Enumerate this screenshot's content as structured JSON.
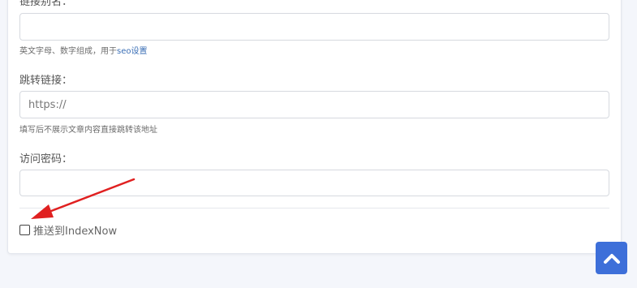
{
  "form": {
    "slug_label": "链接别名：",
    "slug_value": "",
    "slug_help_prefix": "英文字母、数字组成，用于",
    "slug_help_link": "seo设置",
    "redirect_label": "跳转链接：",
    "redirect_placeholder": "https://",
    "redirect_help": "填写后不展示文章内容直接跳转该地址",
    "password_label": "访问密码：",
    "password_value": "",
    "indexnow_label": "推送到IndexNow",
    "indexnow_checked": false
  },
  "icons": {
    "back_to_top": "chevron-up-icon",
    "annotation": "red-arrow"
  },
  "colors": {
    "accent": "#3d6fd9",
    "link": "#3b6fb6",
    "annotation_arrow": "#e02020"
  }
}
